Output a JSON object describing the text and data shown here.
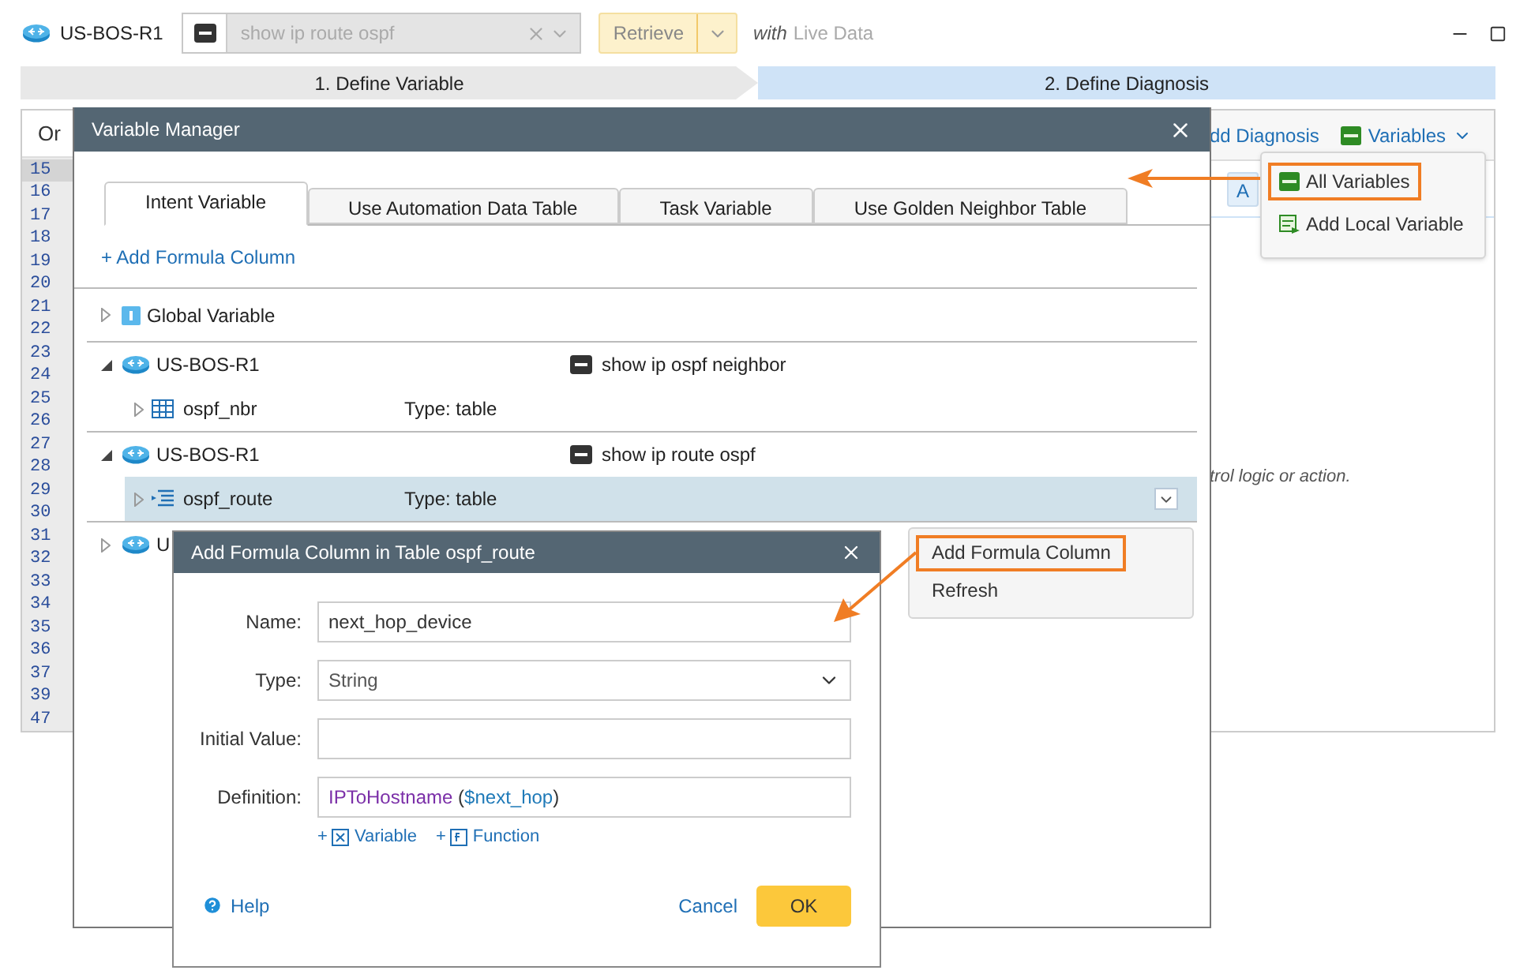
{
  "toolbar": {
    "device": "US-BOS-R1",
    "command": {
      "value": "show ip route ospf",
      "disabled": true
    },
    "retrieve_button": "Retrieve",
    "mode_prefix": "with",
    "mode": "Live Data"
  },
  "steps": [
    {
      "label": "1. Define Variable",
      "selected": false
    },
    {
      "label": "2. Define Diagnosis",
      "selected": true
    }
  ],
  "editor": {
    "header": "Or",
    "lines": [
      {
        "number": "15",
        "selected": true
      },
      {
        "number": "16",
        "selected": false
      },
      {
        "number": "17",
        "selected": false
      },
      {
        "number": "18",
        "selected": false
      },
      {
        "number": "19",
        "selected": false
      },
      {
        "number": "20",
        "selected": false
      },
      {
        "number": "21",
        "selected": false
      },
      {
        "number": "22",
        "selected": false
      },
      {
        "number": "23",
        "selected": false
      },
      {
        "number": "24",
        "selected": false
      },
      {
        "number": "25",
        "selected": false
      },
      {
        "number": "26",
        "selected": false
      },
      {
        "number": "27",
        "selected": false
      },
      {
        "number": "28",
        "selected": false
      },
      {
        "number": "29",
        "selected": false
      },
      {
        "number": "30",
        "selected": false
      },
      {
        "number": "31",
        "selected": false
      },
      {
        "number": "32",
        "selected": false
      },
      {
        "number": "33",
        "selected": false
      },
      {
        "number": "34",
        "selected": false
      },
      {
        "number": "35",
        "selected": false
      },
      {
        "number": "36",
        "selected": false
      },
      {
        "number": "37",
        "selected": false
      },
      {
        "number": "39",
        "selected": false
      },
      {
        "number": "47",
        "selected": false
      }
    ]
  },
  "diagnosis_panel": {
    "add_diagnosis": "dd Diagnosis",
    "variables_button": "Variables",
    "button_stub": "A",
    "hint": "trol logic or action."
  },
  "variables_menu": {
    "items": [
      {
        "label": "All Variables",
        "kind": "all",
        "highlighted": true
      },
      {
        "label": "Add Local Variable",
        "kind": "add",
        "highlighted": false
      }
    ]
  },
  "variable_manager": {
    "title": "Variable Manager",
    "tabs": [
      {
        "label": "Intent Variable",
        "selected": true
      },
      {
        "label": "Use Automation Data Table",
        "selected": false
      },
      {
        "label": "Task Variable",
        "selected": false
      },
      {
        "label": "Use Golden Neighbor Table",
        "selected": false
      }
    ],
    "add_formula": "+ Add Formula Column",
    "groups": [
      {
        "kind": "global",
        "label": "Global Variable",
        "expanded": false
      },
      {
        "kind": "device",
        "label": "US-BOS-R1",
        "expanded": true,
        "command": "show ip ospf neighbor",
        "children": [
          {
            "kind": "table",
            "name": "ospf_nbr",
            "type": "Type: table",
            "selected": false
          }
        ]
      },
      {
        "kind": "device",
        "label": "US-BOS-R1",
        "expanded": true,
        "command": "show ip route ospf",
        "children": [
          {
            "kind": "list",
            "name": "ospf_route",
            "type": "Type: table",
            "selected": true
          }
        ]
      },
      {
        "kind": "device",
        "label": "U",
        "expanded": false
      }
    ]
  },
  "context_menu": {
    "items": [
      {
        "label": "Add Formula Column",
        "highlighted": true
      },
      {
        "label": "Refresh",
        "highlighted": false
      }
    ]
  },
  "formula_dialog": {
    "title": "Add Formula Column in Table ospf_route",
    "fields": [
      {
        "kind": "text",
        "label": "Name:",
        "value": "next_hop_device"
      },
      {
        "kind": "select",
        "label": "Type:",
        "value": "String"
      },
      {
        "kind": "text",
        "label": "Initial Value:"
      },
      {
        "kind": "formula",
        "label": "Definition:",
        "parts": [
          {
            "kind": "function",
            "text": "IPToHostname"
          },
          {
            "kind": "plain",
            "text": " ("
          },
          {
            "kind": "variable",
            "text": "$next_hop"
          },
          {
            "kind": "plain",
            "text": ")"
          }
        ]
      }
    ],
    "insert_links": [
      {
        "prefix": "+",
        "label": "Variable",
        "kind": "variable"
      },
      {
        "prefix": "+",
        "label": "Function",
        "kind": "function"
      }
    ],
    "help": "Help",
    "cancel": "Cancel",
    "ok": "OK"
  }
}
